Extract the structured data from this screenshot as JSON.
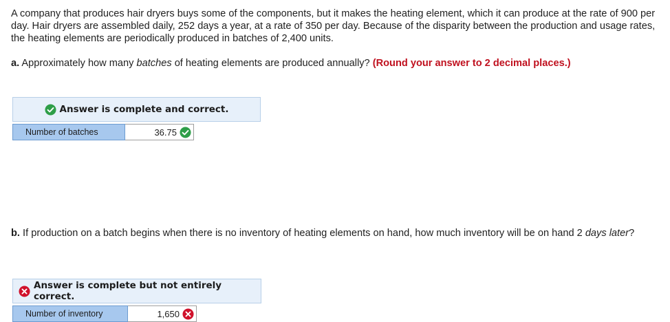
{
  "intro": {
    "text": "A company that produces hair dryers buys some of the components, but it makes the heating element, which it can produce at the rate of 900 per day. Hair dryers are assembled daily, 252 days a year, at a rate of 350 per day. Because of the disparity between the production and usage rates, the heating elements are periodically produced in batches of 2,400 units."
  },
  "part_a": {
    "label": "a.",
    "text_before": " Approximately how many ",
    "text_em": "batches",
    "text_after": " of heating elements are produced annually? ",
    "round_note": "(Round your answer to 2 decimal places.)",
    "status": "Answer is complete and correct.",
    "status_icon": "check-circle-icon",
    "status_color": "#2e9e48",
    "answer_label": "Number of batches",
    "answer_value": "36.75",
    "answer_mark": "check-circle-icon"
  },
  "part_b": {
    "label": "b.",
    "text_before": " If production on a batch begins when there is no inventory of heating elements on hand, how much inventory will be on hand 2 ",
    "text_em": "days later",
    "text_after": "?",
    "status": "Answer is complete but not entirely correct.",
    "status_icon": "x-circle-icon",
    "status_color": "#d0112b",
    "answer_label": "Number of inventory",
    "answer_value": "1,650",
    "answer_mark": "x-circle-icon"
  }
}
